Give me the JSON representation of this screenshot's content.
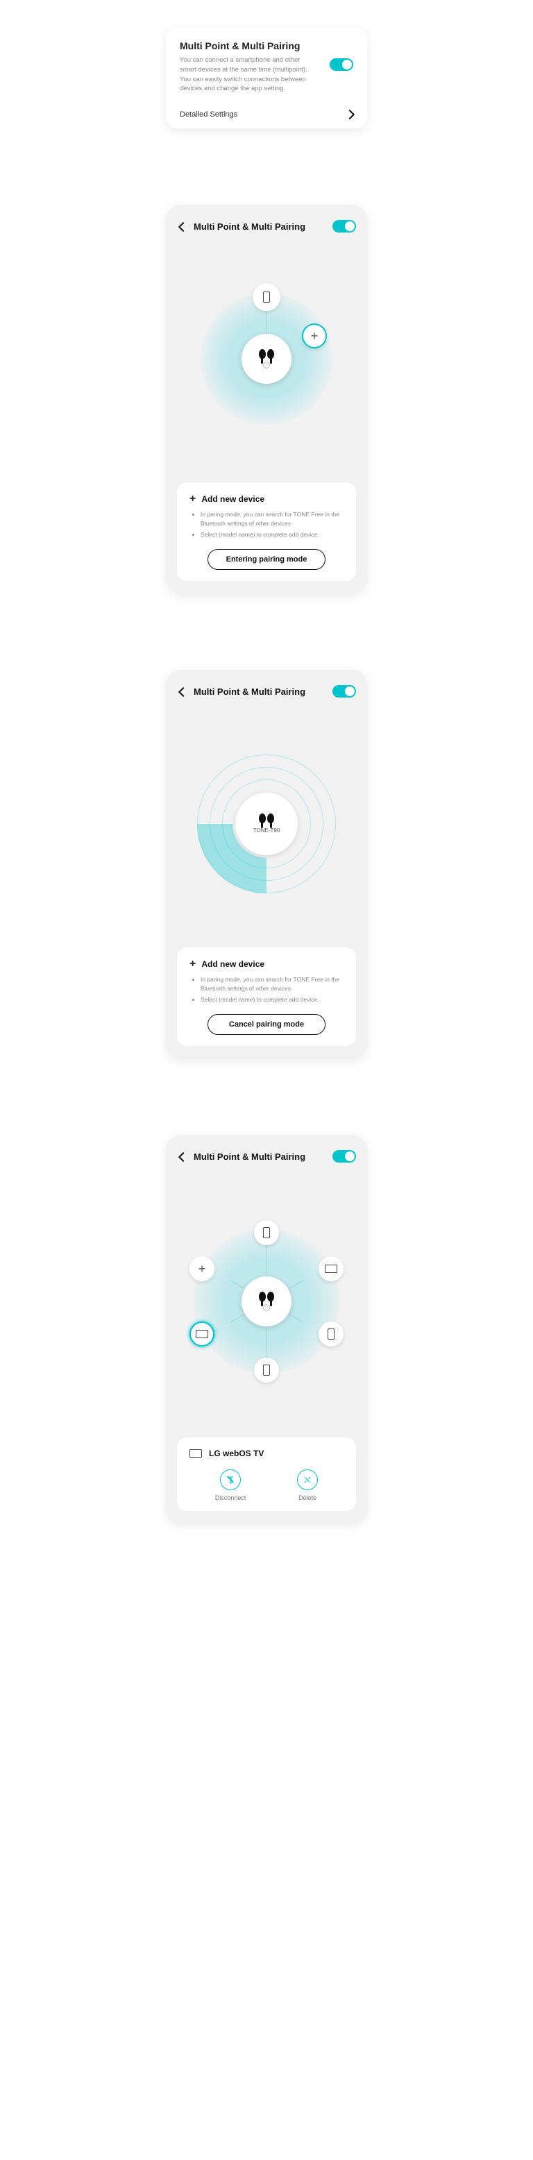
{
  "summary": {
    "title": "Multi Point & Multi Pairing",
    "desc": "You can connect a smartphone and other smart devices at the same time (multipoint). You can easily switch connections between devices and change the app setting.",
    "link": "Detailed Settings"
  },
  "header_title": "Multi Point & Multi Pairing",
  "add_panel": {
    "title": "Add new device",
    "bullet1": "In paring mode, you can search for TONE Free in the Bluetooth settings of other devices",
    "bullet2": "Select (model name) to complete add device."
  },
  "buttons": {
    "enter_pairing": "Entering pairing mode",
    "cancel_pairing": "Cancel pairing mode"
  },
  "radar": {
    "device_name": "TONE-T90"
  },
  "selected_device": {
    "name": "LG webOS TV",
    "action_disconnect": "Disconnect",
    "action_delete": "Delete"
  }
}
